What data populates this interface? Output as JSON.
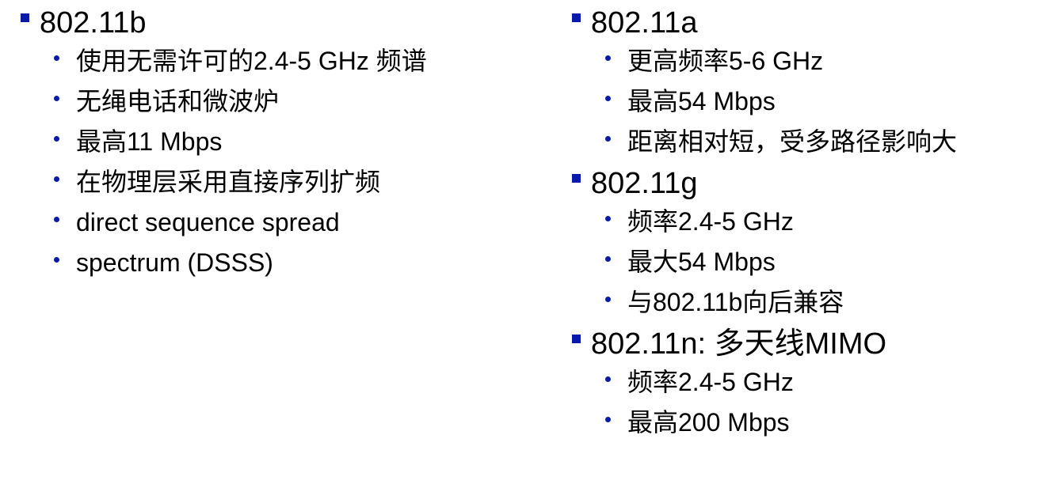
{
  "left": {
    "heading": "802.11b",
    "items": [
      "使用无需许可的2.4-5 GHz 频谱",
      "无绳电话和微波炉",
      "最高11 Mbps",
      "在物理层采用直接序列扩频",
      "direct sequence spread",
      "spectrum (DSSS)"
    ]
  },
  "right": {
    "sections": [
      {
        "heading": "802.11a",
        "items": [
          "更高频率5-6 GHz",
          "最高54 Mbps",
          "距离相对短，受多路径影响大"
        ]
      },
      {
        "heading": "802.11g",
        "items": [
          "频率2.4-5 GHz",
          "最大54 Mbps",
          "与802.11b向后兼容"
        ]
      },
      {
        "heading": "802.11n: 多天线MIMO",
        "items": [
          "频率2.4-5 GHz",
          "最高200 Mbps"
        ]
      }
    ]
  },
  "colors": {
    "bullet": "#0a1aa8",
    "text": "#000000",
    "background": "#ffffff"
  }
}
